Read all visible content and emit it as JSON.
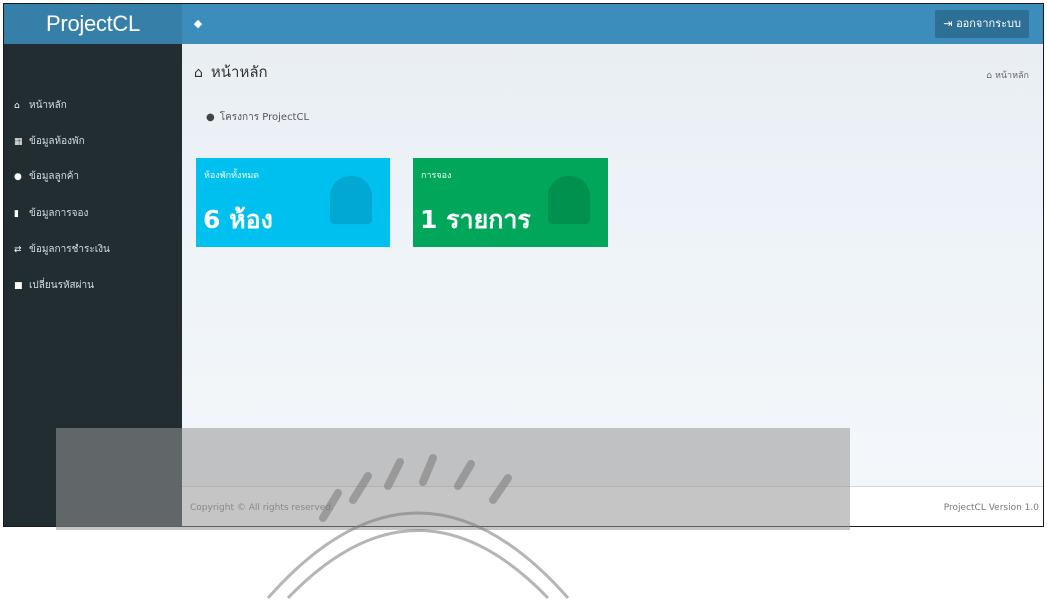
{
  "app": {
    "brand": "ProjectCL",
    "logout_label": "ออกจากระบบ"
  },
  "sidebar": {
    "items": [
      {
        "label": "หน้าหลัก",
        "icon": "home-icon"
      },
      {
        "label": "ข้อมูลห้องพัก",
        "icon": "grid-icon"
      },
      {
        "label": "ข้อมูลลูกค้า",
        "icon": "user-icon"
      },
      {
        "label": "ข้อมูลการจอง",
        "icon": "document-icon"
      },
      {
        "label": "ข้อมูลการชำระเงิน",
        "icon": "exchange-icon"
      },
      {
        "label": "เปลี่ยนรหัสผ่าน",
        "icon": "lock-icon"
      }
    ]
  },
  "page": {
    "title": "หน้าหลัก",
    "breadcrumb": "หน้าหลัก",
    "welcome": "โครงการ ProjectCL"
  },
  "boxes": [
    {
      "label": "ห้องพักทั้งหมด",
      "value": "6 ห้อง",
      "color": "#00c0ef"
    },
    {
      "label": "การจอง",
      "value": "1 รายการ",
      "color": "#00a65a"
    }
  ],
  "footer": {
    "left": "Copyright © All rights reserved.",
    "right": "ProjectCL Version 1.0"
  },
  "colors": {
    "topbar": "#3c8dbc",
    "sidebar": "#222d32"
  }
}
